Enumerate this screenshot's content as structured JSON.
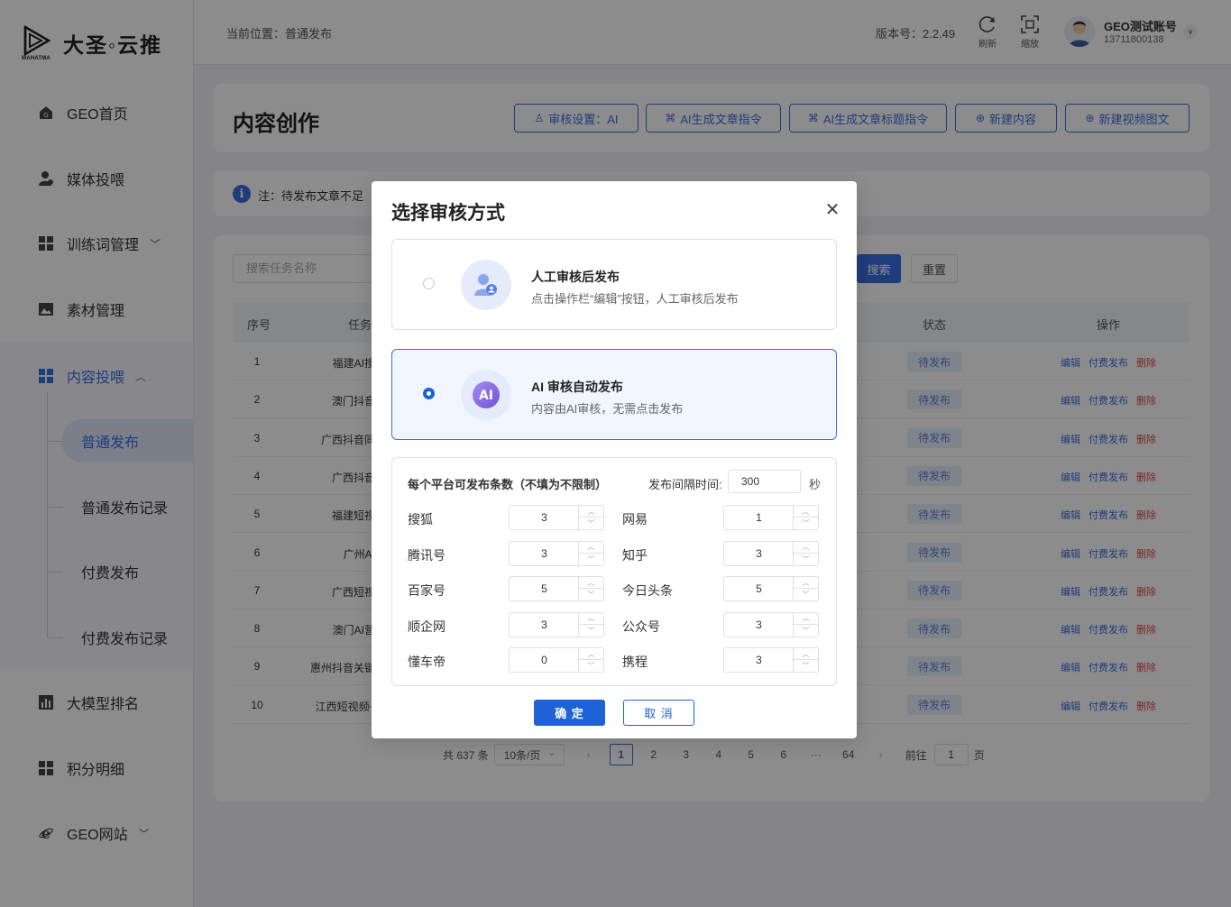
{
  "brand": {
    "name": "大圣◦云推",
    "sub": "MAHATMA"
  },
  "sidebar": {
    "items": [
      {
        "label": "GEO首页",
        "icon": "home-icon"
      },
      {
        "label": "媒体投喂",
        "icon": "user-icon"
      },
      {
        "label": "训练词管理",
        "icon": "grid-icon"
      },
      {
        "label": "素材管理",
        "icon": "image-icon"
      },
      {
        "label": "内容投喂",
        "icon": "grid-icon"
      },
      {
        "label": "大模型排名",
        "icon": "bar-chart-icon"
      },
      {
        "label": "积分明细",
        "icon": "grid-icon"
      },
      {
        "label": "GEO网站",
        "icon": "ie-icon"
      }
    ],
    "sub_items": [
      {
        "label": "普通发布"
      },
      {
        "label": "普通发布记录"
      },
      {
        "label": "付费发布"
      },
      {
        "label": "付费发布记录"
      }
    ]
  },
  "header": {
    "breadcrumb": "当前位置：普通发布",
    "version": "版本号：2.2.49",
    "refresh_label": "刷新",
    "zoom_label": "缩放",
    "account_name": "GEO测试账号",
    "account_phone": "13711800138"
  },
  "title_card": {
    "title": "内容创作",
    "buttons": [
      {
        "label": "审核设置：AI",
        "icon": "audit-icon"
      },
      {
        "label": "AI生成文章指令",
        "icon": "command-icon"
      },
      {
        "label": "AI生成文章标题指令",
        "icon": "command-icon"
      },
      {
        "label": "新建内容",
        "icon": "plus-circle-icon"
      },
      {
        "label": "新建视频图文",
        "icon": "plus-circle-icon"
      }
    ]
  },
  "note": {
    "text": "注：待发布文章不足"
  },
  "table": {
    "search_placeholder": "搜索任务名称",
    "search_label": "搜索",
    "reset_label": "重置",
    "columns": {
      "no": "序号",
      "task": "任务",
      "status": "状态",
      "ops": "操作"
    },
    "rows": [
      {
        "no": "1",
        "name": "福建AI搜索",
        "status": "待发布"
      },
      {
        "no": "2",
        "name": "澳门抖音推",
        "status": "待发布"
      },
      {
        "no": "3",
        "name": "广西抖音同城",
        "status": "待发布"
      },
      {
        "no": "4",
        "name": "广西抖音推",
        "status": "待发布"
      },
      {
        "no": "5",
        "name": "福建短视频",
        "status": "待发布"
      },
      {
        "no": "6",
        "name": "广州AI推",
        "status": "待发布"
      },
      {
        "no": "7",
        "name": "广西短视频",
        "status": "待发布"
      },
      {
        "no": "8",
        "name": "澳门AI营销",
        "status": "待发布"
      },
      {
        "no": "9",
        "name": "惠州抖音关键词",
        "status": "待发布"
      },
      {
        "no": "10",
        "name": "江西短视频+AI",
        "status": "待发布"
      }
    ],
    "ops": {
      "edit": "编辑",
      "pay": "付费发布",
      "del": "删除"
    }
  },
  "pager": {
    "total": "共 637 条",
    "page_size": "10条/页",
    "pages": [
      "1",
      "2",
      "3",
      "4",
      "5",
      "6",
      "···",
      "64"
    ],
    "current": "1",
    "goto_label": "前往",
    "goto_value": "1",
    "page_unit": "页"
  },
  "modal": {
    "title": "选择审核方式",
    "options": [
      {
        "title": "人工审核后发布",
        "desc": "点击操作栏“编辑”按钮，人工审核后发布",
        "selected": false
      },
      {
        "title": "AI 审核自动发布",
        "desc": "内容由AI审核，无需点击发布",
        "selected": true
      }
    ],
    "ai_badge": "AI",
    "limits_label": "每个平台可发布条数（不填为不限制）",
    "interval_label": "发布间隔时间:",
    "interval_value": "300",
    "interval_unit": "秒",
    "platforms": [
      {
        "name": "搜狐",
        "value": "3"
      },
      {
        "name": "网易",
        "value": "1"
      },
      {
        "name": "腾讯号",
        "value": "3"
      },
      {
        "name": "知乎",
        "value": "3"
      },
      {
        "name": "百家号",
        "value": "5"
      },
      {
        "name": "今日头条",
        "value": "5"
      },
      {
        "name": "顺企网",
        "value": "3"
      },
      {
        "name": "公众号",
        "value": "3"
      },
      {
        "name": "懂车帝",
        "value": "0"
      },
      {
        "name": "携程",
        "value": "3"
      }
    ],
    "ok_label": "确 定",
    "cancel_label": "取 消"
  }
}
